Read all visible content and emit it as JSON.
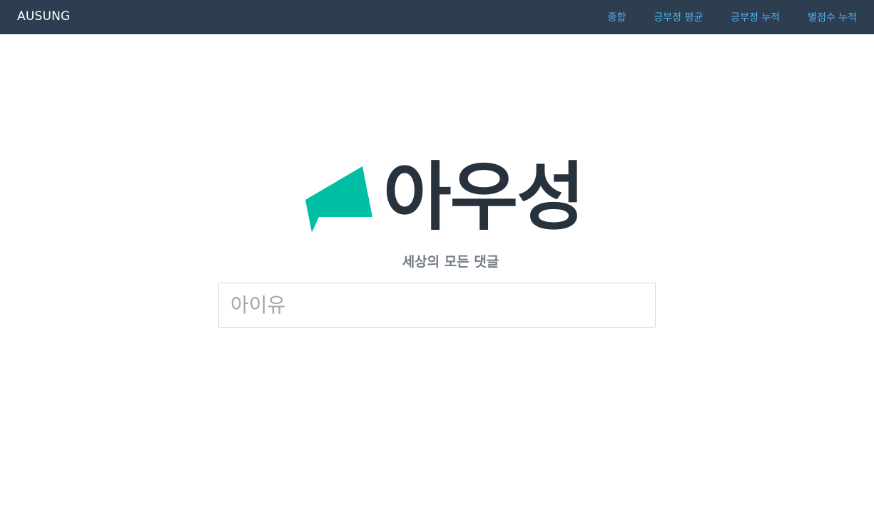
{
  "navbar": {
    "brand": "AUSUNG",
    "background": "#2c3e50",
    "link_color": "#55b3f0",
    "links": [
      {
        "label": "종합"
      },
      {
        "label": "긍부정 평균"
      },
      {
        "label": "긍부정 누적"
      },
      {
        "label": "별점수 누적"
      }
    ]
  },
  "hero": {
    "logo_text": "아우성",
    "logo_icon": "speech-bubble-icon",
    "logo_icon_color": "#00bfa5",
    "logo_text_color": "#27323d",
    "tagline": "세상의 모든 댓글"
  },
  "search": {
    "placeholder": "아이유",
    "value": ""
  }
}
